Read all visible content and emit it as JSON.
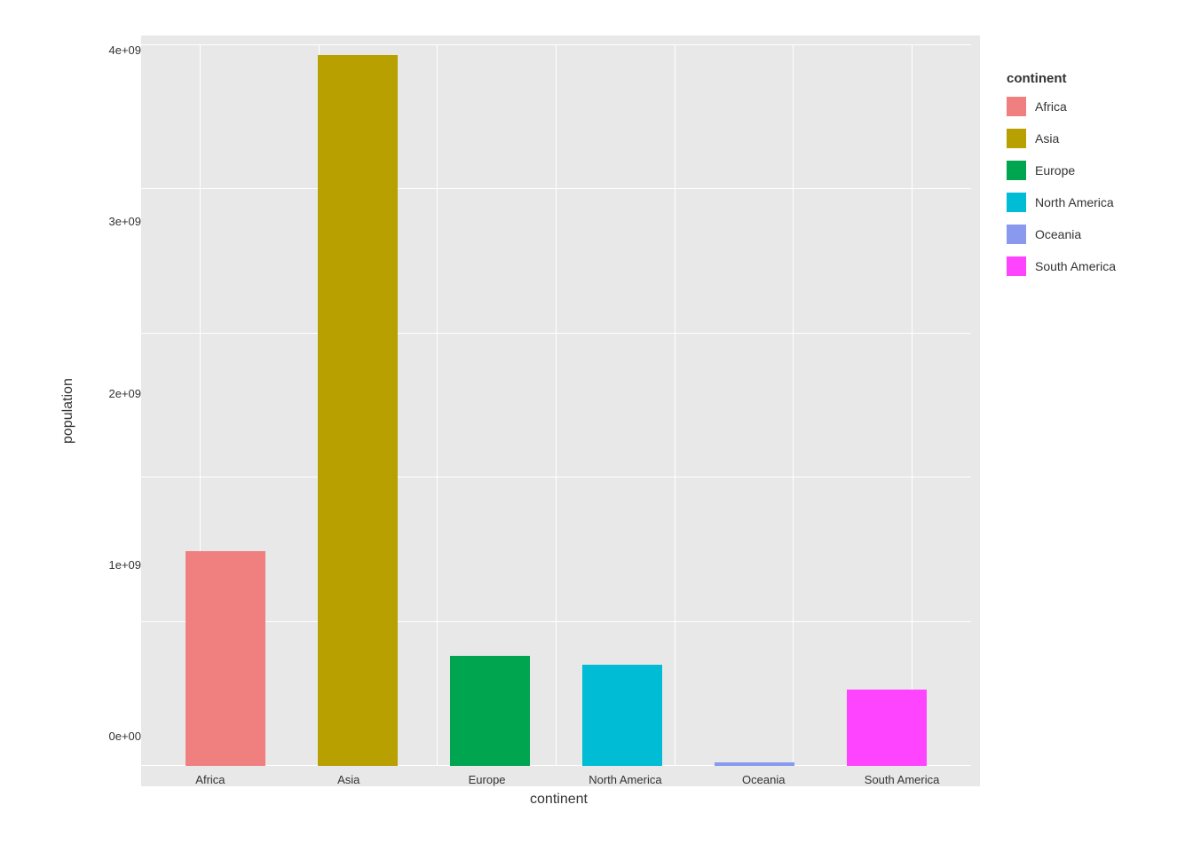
{
  "chart": {
    "title": "",
    "y_axis_label": "population",
    "x_axis_label": "continent",
    "legend_title": "continent",
    "background_color": "#e8e8e8",
    "y_ticks": [
      "0e+00",
      "1e+09",
      "2e+09",
      "3e+09",
      "4e+09"
    ],
    "bars": [
      {
        "continent": "Africa",
        "value": 1400000000.0,
        "max": 4700000000.0,
        "color": "#F08080",
        "pct": 29.8
      },
      {
        "continent": "Asia",
        "value": 4700000000.0,
        "max": 4700000000.0,
        "color": "#B8A000",
        "pct": 98.5
      },
      {
        "continent": "Europe",
        "value": 720000000.0,
        "max": 4700000000.0,
        "color": "#00A550",
        "pct": 15.3
      },
      {
        "continent": "North America",
        "value": 660000000.0,
        "max": 4700000000.0,
        "color": "#00BCD4",
        "pct": 14.0
      },
      {
        "continent": "Oceania",
        "value": 25000000.0,
        "max": 4700000000.0,
        "color": "#8899EE",
        "pct": 0.5
      },
      {
        "continent": "South America",
        "value": 500000000.0,
        "max": 4700000000.0,
        "color": "#FF44FF",
        "pct": 10.6
      }
    ],
    "legend_items": [
      {
        "label": "Africa",
        "color": "#F08080"
      },
      {
        "label": "Asia",
        "color": "#B8A000"
      },
      {
        "label": "Europe",
        "color": "#00A550"
      },
      {
        "label": "North America",
        "color": "#00BCD4"
      },
      {
        "label": "Oceania",
        "color": "#8899EE"
      },
      {
        "label": "South America",
        "color": "#FF44FF"
      }
    ]
  }
}
